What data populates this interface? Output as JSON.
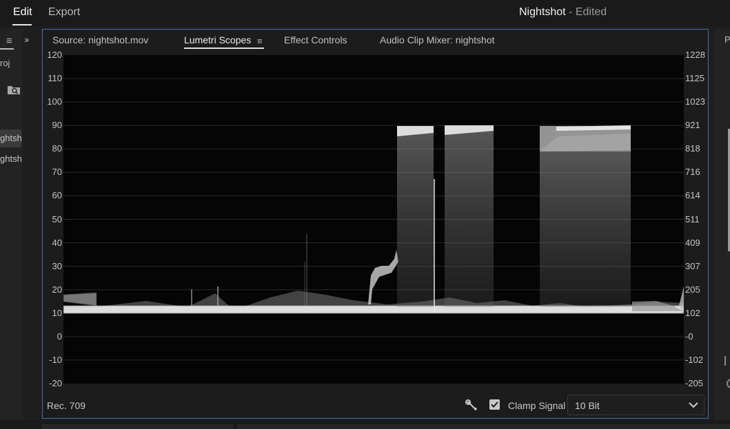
{
  "menu": {
    "edit": "Edit",
    "export": "Export"
  },
  "app_title": {
    "project": "Nightshot",
    "status": " - Edited"
  },
  "left_panel": {
    "tab_label": "roj",
    "clips": [
      "ghtsho",
      "ghtsho"
    ],
    "icons": {
      "menu": "hamburger-icon",
      "expand": "chevrons-right-icon",
      "search": "search-bin-icon"
    }
  },
  "right_panel": {
    "tab_label": "P"
  },
  "scopes_panel": {
    "tabs": [
      {
        "label": "Source: nightshot.mov",
        "active": false
      },
      {
        "label": "Lumetri Scopes",
        "active": true
      },
      {
        "label": "Effect Controls",
        "active": false
      },
      {
        "label": "Audio Clip Mixer: nightshot",
        "active": false
      }
    ],
    "scope": {
      "type": "waveform",
      "ire_labels": [
        "120",
        "110",
        "100",
        "90",
        "80",
        "70",
        "60",
        "50",
        "40",
        "30",
        "20",
        "10",
        "0",
        "-10",
        "-20"
      ],
      "code_labels": [
        "1228",
        "1125",
        "1023",
        "921",
        "818",
        "716",
        "614",
        "511",
        "409",
        "307",
        "205",
        "102",
        "-0",
        "-102",
        "-205"
      ],
      "ire_range": [
        -20,
        120
      ],
      "grid": true,
      "trace_color": "#e6e6e6",
      "background_color": "#050505"
    },
    "bottom": {
      "color_space": "Rec. 709",
      "clamp_label": "Clamp Signal",
      "clamp_checked": true,
      "bit_depth": "10 Bit",
      "icons": {
        "settings": "wrench-icon",
        "dropdown": "chevron-down-icon"
      }
    }
  },
  "colors": {
    "accent_border": "#3f72ab",
    "panel_bg": "#1c1c1c",
    "app_bg": "#1a1a1a"
  }
}
